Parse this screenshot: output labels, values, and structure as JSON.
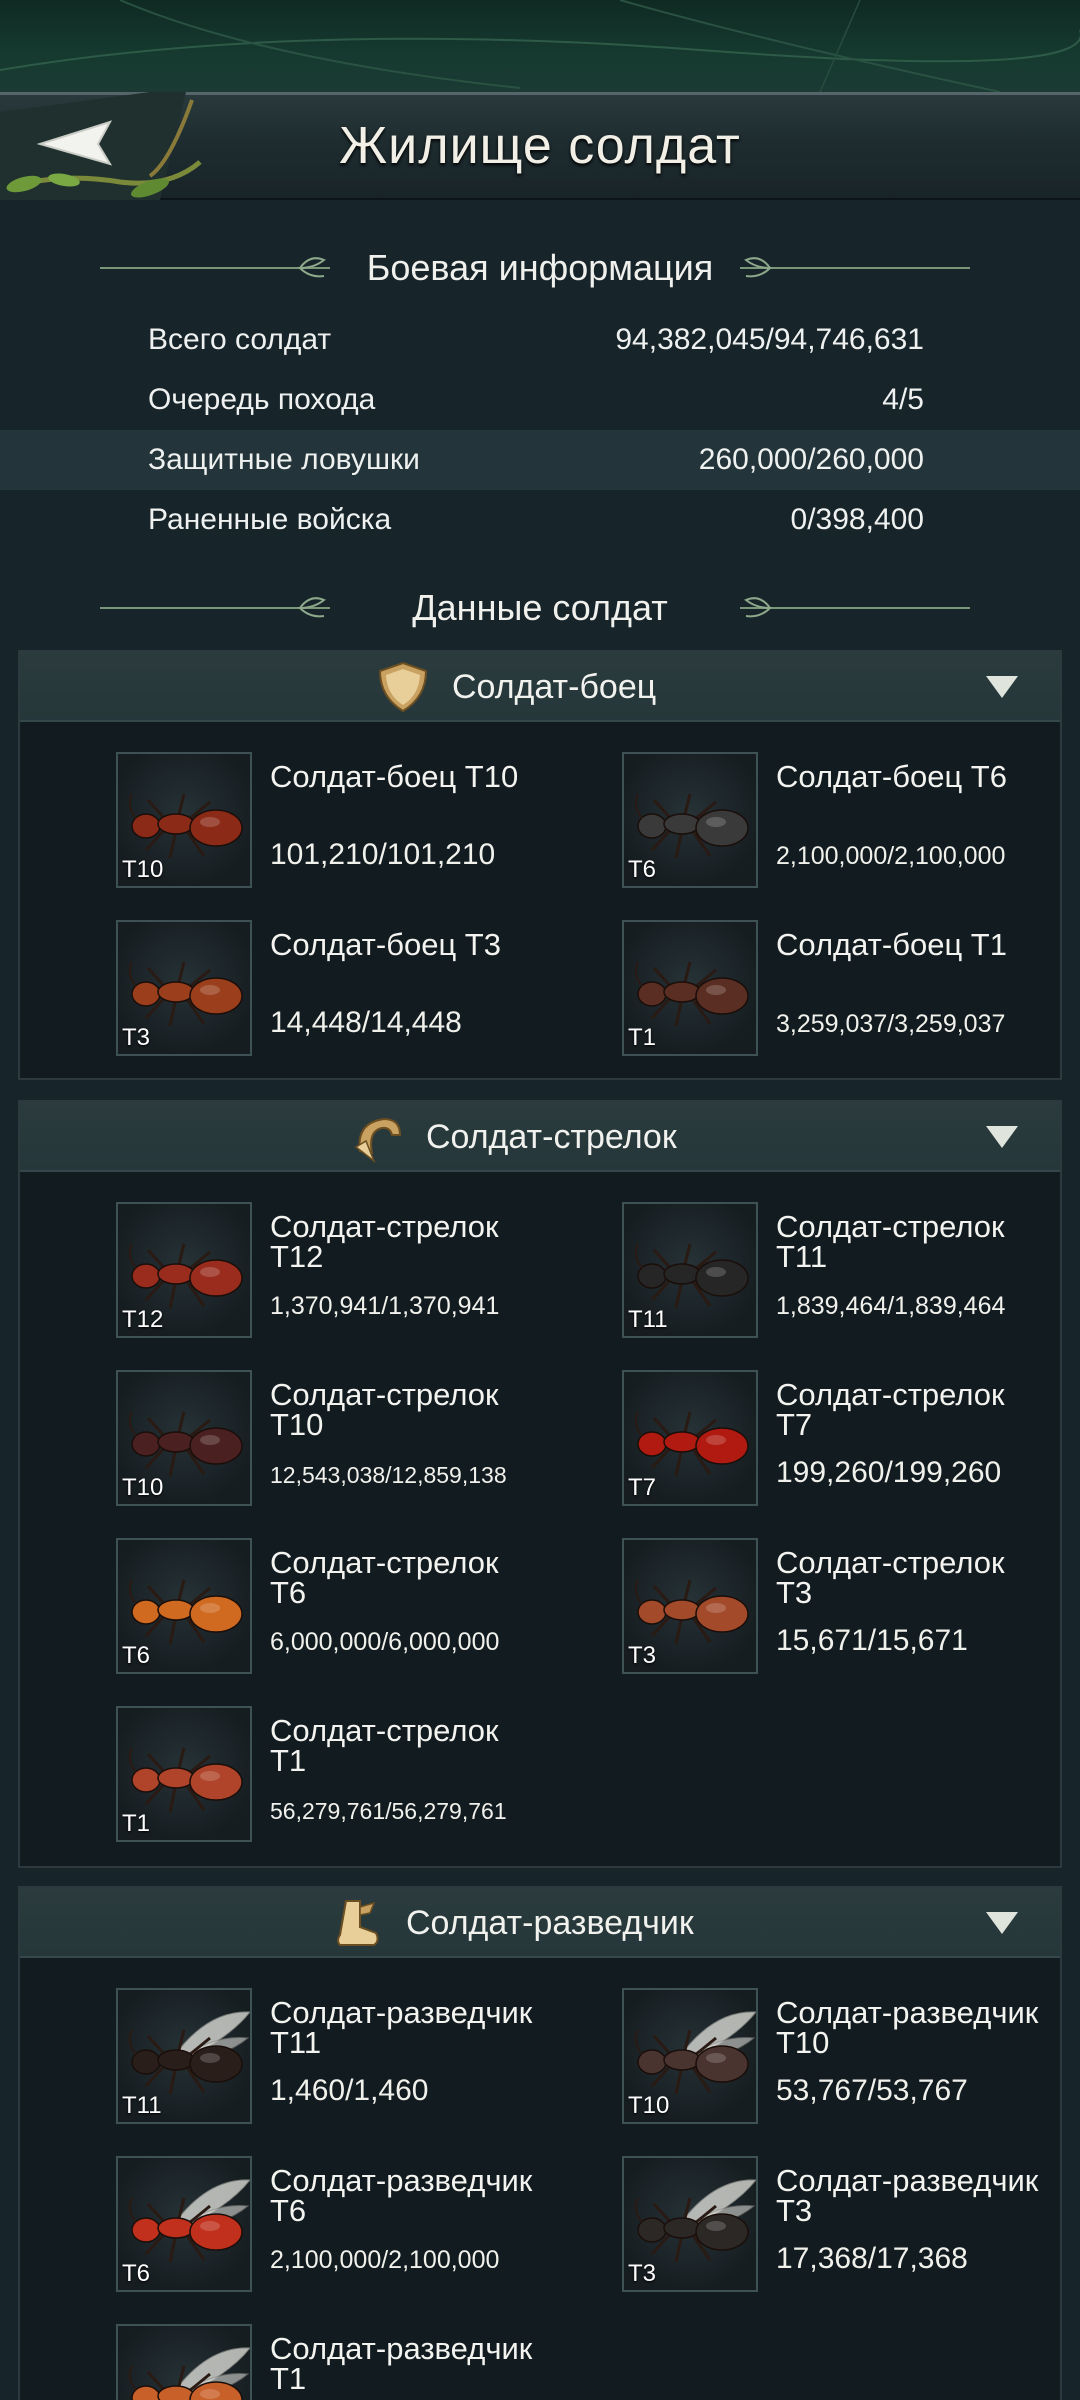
{
  "header": {
    "title": "Жилище солдат"
  },
  "battle_info": {
    "heading": "Боевая информация",
    "rows": [
      {
        "label": "Всего солдат",
        "value": "94,382,045/94,746,631"
      },
      {
        "label": "Очередь похода",
        "value": "4/5"
      },
      {
        "label": "Защитные ловушки",
        "value": "260,000/260,000"
      },
      {
        "label": "Раненные войска",
        "value": "0/398,400"
      }
    ]
  },
  "soldier_data": {
    "heading": "Данные солдат"
  },
  "groups": [
    {
      "title": "Солдат-боец",
      "icon": "shield-icon",
      "units": [
        {
          "name": "Солдат-боец Т10",
          "count": "101,210/101,210",
          "tier": "T10",
          "color": "#8c2a18"
        },
        {
          "name": "Солдат-боец Т6",
          "count": "2,100,000/2,100,000",
          "tier": "T6",
          "color": "#3a3a3a"
        },
        {
          "name": "Солдат-боец Т3",
          "count": "14,448/14,448",
          "tier": "T3",
          "color": "#9a3e1c"
        },
        {
          "name": "Солдат-боец Т1",
          "count": "3,259,037/3,259,037",
          "tier": "T1",
          "color": "#5a2e22"
        }
      ]
    },
    {
      "title": "Солдат-стрелок",
      "icon": "horn-icon",
      "units": [
        {
          "name": "Солдат-стрелок Т12",
          "count": "1,370,941/1,370,941",
          "tier": "T12",
          "color": "#9a2c1e"
        },
        {
          "name": "Солдат-стрелок Т11",
          "count": "1,839,464/1,839,464",
          "tier": "T11",
          "color": "#262626"
        },
        {
          "name": "Солдат-стрелок Т10",
          "count": "12,543,038/12,859,138",
          "tier": "T10",
          "color": "#4a2020"
        },
        {
          "name": "Солдат-стрелок Т7",
          "count": "199,260/199,260",
          "tier": "T7",
          "color": "#b01a10"
        },
        {
          "name": "Солдат-стрелок Т6",
          "count": "6,000,000/6,000,000",
          "tier": "T6",
          "color": "#d06a20"
        },
        {
          "name": "Солдат-стрелок Т3",
          "count": "15,671/15,671",
          "tier": "T3",
          "color": "#a24a2a"
        },
        {
          "name": "Солдат-стрелок Т1",
          "count": "56,279,761/56,279,761",
          "tier": "T1",
          "color": "#b0442a"
        }
      ]
    },
    {
      "title": "Солдат-разведчик",
      "icon": "boot-icon",
      "units": [
        {
          "name": "Солдат-разведчик Т11",
          "count": "1,460/1,460",
          "tier": "T11",
          "color": "#2a1e1a"
        },
        {
          "name": "Солдат-разведчик Т10",
          "count": "53,767/53,767",
          "tier": "T10",
          "color": "#4a3430"
        },
        {
          "name": "Солдат-разведчик Т6",
          "count": "2,100,000/2,100,000",
          "tier": "T6",
          "color": "#c0301c"
        },
        {
          "name": "Солдат-разведчик Т3",
          "count": "17,368/17,368",
          "tier": "T3",
          "color": "#2c2826"
        },
        {
          "name": "Солдат-разведчик Т1",
          "count": "",
          "tier": "",
          "color": "#c8602a"
        }
      ]
    }
  ]
}
